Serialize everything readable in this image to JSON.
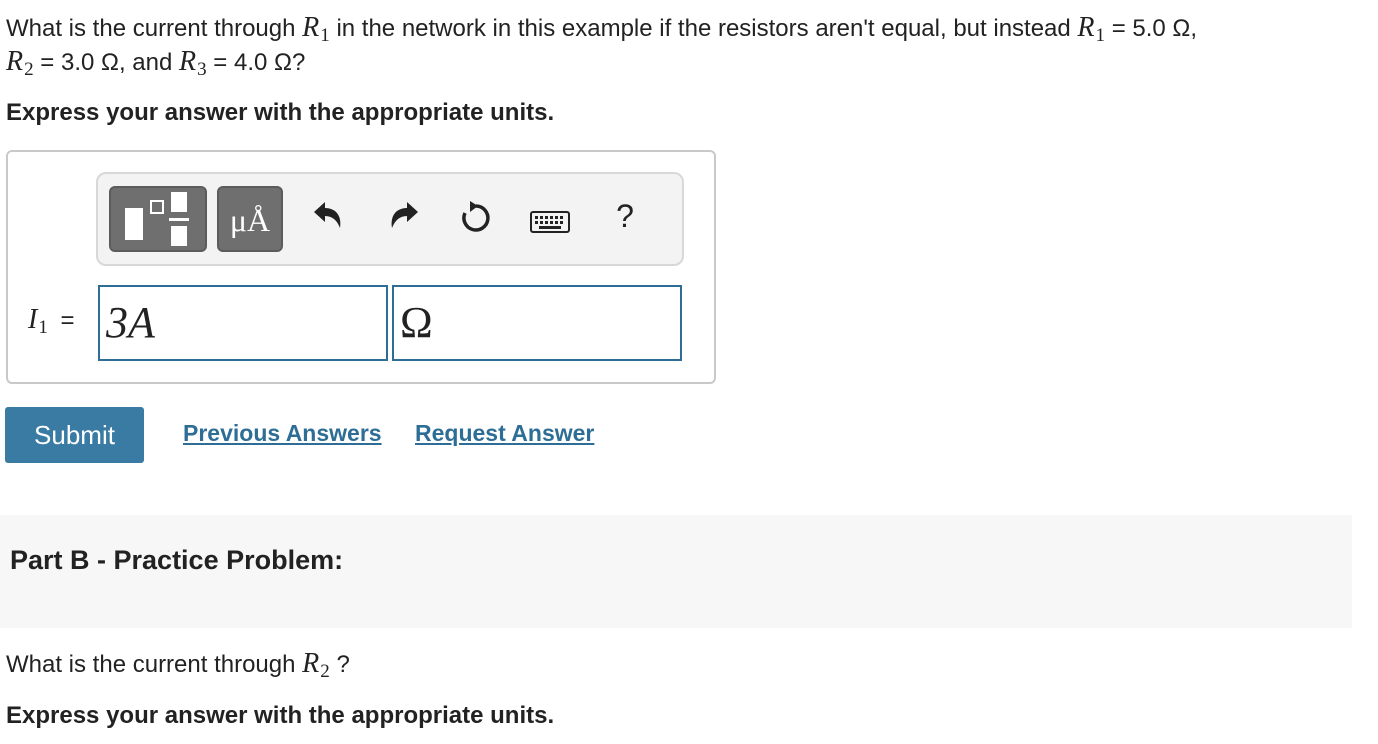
{
  "question": {
    "text_1": "What is the current through",
    "r1_symbol": "R",
    "r1_sub": "1",
    "text_2": "in the network in this example if the resistors aren't equal, but instead",
    "r1b_symbol": "R",
    "r1b_sub": "1",
    "r1_value": "= 5.0 Ω,",
    "r2_symbol": "R",
    "r2_sub": "2",
    "r2_value": "= 3.0 Ω, and",
    "r3_symbol": "R",
    "r3_sub": "3",
    "r3_value": "= 4.0 Ω?"
  },
  "instruction_a": "Express your answer with the appropriate units.",
  "toolbar": {
    "units_label": "μÅ",
    "help_label": "?"
  },
  "answer": {
    "variable_symbol": "I",
    "variable_sub": "1",
    "equals": "=",
    "value": "3A",
    "unit": "Ω"
  },
  "actions": {
    "submit_label": "Submit",
    "previous_answers_label": "Previous Answers",
    "request_answer_label": "Request Answer"
  },
  "part_b": {
    "title": "Part B - Practice Problem:",
    "question_text": "What is the current through",
    "r_symbol": "R",
    "r_sub": "2",
    "question_end": "?",
    "instruction": "Express your answer with the appropriate units."
  },
  "colors": {
    "accent": "#3a7ba4",
    "link": "#2e6e96",
    "input_border": "#2e6e96",
    "toolbar_button": "#6f6f6f"
  }
}
